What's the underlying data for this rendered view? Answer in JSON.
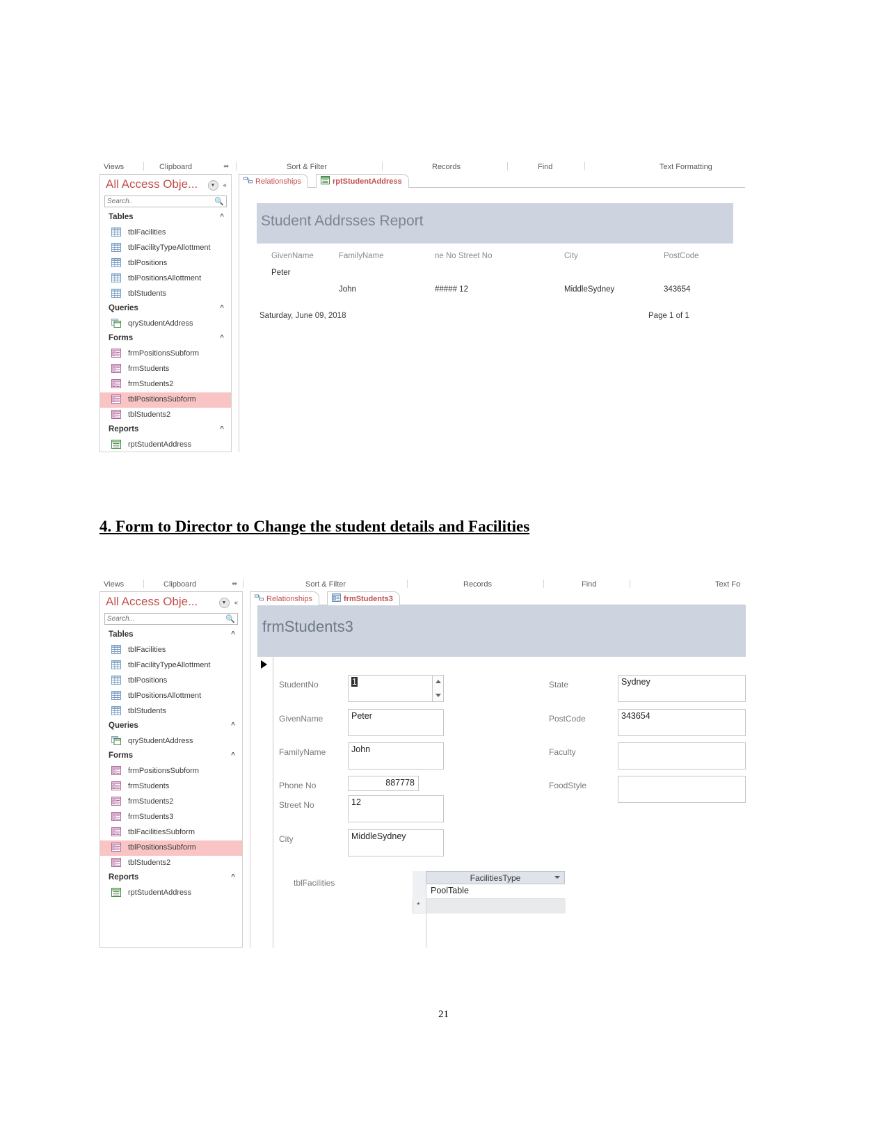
{
  "document": {
    "page_number": "21",
    "heading": "4. Form to Director to Change the student details and Facilities"
  },
  "screenshot_report": {
    "ribbon_groups": [
      "Views",
      "Clipboard",
      "Sort & Filter",
      "Records",
      "Find",
      "Text Formatting"
    ],
    "dialog_launcher": "⬌",
    "nav_pane": {
      "title": "All Access Obje...",
      "dropdown_icon": "chevron-down-icon",
      "collapse_icon": "«",
      "search_placeholder": "Search..",
      "search_icon": "search-icon",
      "groups": [
        {
          "label": "Tables",
          "collapse_chevron": "«",
          "items": [
            {
              "label": "tblFacilities",
              "icon": "table-icon"
            },
            {
              "label": "tblFacilityTypeAllottment",
              "icon": "table-icon"
            },
            {
              "label": "tblPositions",
              "icon": "table-icon"
            },
            {
              "label": "tblPositionsAllottment",
              "icon": "table-icon"
            },
            {
              "label": "tblStudents",
              "icon": "table-icon"
            }
          ]
        },
        {
          "label": "Queries",
          "collapse_chevron": "«",
          "items": [
            {
              "label": "qryStudentAddress",
              "icon": "query-icon"
            }
          ]
        },
        {
          "label": "Forms",
          "collapse_chevron": "«",
          "items": [
            {
              "label": "frmPositionsSubform",
              "icon": "form-icon"
            },
            {
              "label": "frmStudents",
              "icon": "form-icon"
            },
            {
              "label": "frmStudents2",
              "icon": "form-icon"
            },
            {
              "label": "tblPositionsSubform",
              "icon": "form-icon",
              "selected": true
            },
            {
              "label": "tblStudents2",
              "icon": "form-icon"
            }
          ]
        },
        {
          "label": "Reports",
          "collapse_chevron": "«",
          "items": [
            {
              "label": "rptStudentAddress",
              "icon": "report-icon"
            }
          ]
        }
      ]
    },
    "tabs": [
      {
        "label": "Relationships",
        "icon": "relationships-icon",
        "active": false
      },
      {
        "label": "rptStudentAddress",
        "icon": "report-icon",
        "active": true
      }
    ],
    "report": {
      "title": "Student Addrsses Report",
      "columns": [
        "GivenName",
        "FamilyName",
        "ne No Street No",
        "City",
        "PostCode"
      ],
      "rows": [
        {
          "GivenName": "Peter",
          "FamilyName": "",
          "PhoneStreet": "",
          "City": "",
          "PostCode": ""
        },
        {
          "GivenName": "",
          "FamilyName": "John",
          "PhoneStreet": "#####  12",
          "City": "MiddleSydney",
          "PostCode": "343654"
        }
      ],
      "footer_date": "Saturday, June 09, 2018",
      "footer_page": "Page 1 of 1"
    }
  },
  "screenshot_form": {
    "ribbon_groups": [
      "Views",
      "Clipboard",
      "Sort & Filter",
      "Records",
      "Find",
      "Text Fo"
    ],
    "dialog_launcher": "⬌",
    "nav_pane": {
      "title": "All Access Obje...",
      "dropdown_icon": "chevron-down-icon",
      "collapse_icon": "«",
      "search_placeholder": "Search...",
      "search_icon": "search-icon",
      "groups": [
        {
          "label": "Tables",
          "collapse_chevron": "«",
          "items": [
            {
              "label": "tblFacilities",
              "icon": "table-icon"
            },
            {
              "label": "tblFacilityTypeAllottment",
              "icon": "table-icon"
            },
            {
              "label": "tblPositions",
              "icon": "table-icon"
            },
            {
              "label": "tblPositionsAllottment",
              "icon": "table-icon"
            },
            {
              "label": "tblStudents",
              "icon": "table-icon"
            }
          ]
        },
        {
          "label": "Queries",
          "collapse_chevron": "«",
          "items": [
            {
              "label": "qryStudentAddress",
              "icon": "query-icon"
            }
          ]
        },
        {
          "label": "Forms",
          "collapse_chevron": "«",
          "items": [
            {
              "label": "frmPositionsSubform",
              "icon": "form-icon"
            },
            {
              "label": "frmStudents",
              "icon": "form-icon"
            },
            {
              "label": "frmStudents2",
              "icon": "form-icon"
            },
            {
              "label": "frmStudents3",
              "icon": "form-icon"
            },
            {
              "label": "tblFacilitiesSubform",
              "icon": "form-icon"
            },
            {
              "label": "tblPositionsSubform",
              "icon": "form-icon",
              "selected": true
            },
            {
              "label": "tblStudents2",
              "icon": "form-icon"
            }
          ]
        },
        {
          "label": "Reports",
          "collapse_chevron": "«",
          "items": [
            {
              "label": "rptStudentAddress",
              "icon": "report-icon"
            }
          ]
        }
      ]
    },
    "tabs": [
      {
        "label": "Relationships",
        "icon": "relationships-icon",
        "active": false
      },
      {
        "label": "frmStudents3",
        "icon": "form-icon",
        "active": true
      }
    ],
    "form": {
      "title": "frmStudents3",
      "fields_left": [
        {
          "label": "StudentNo",
          "value": "1",
          "spinner": true,
          "selected": true
        },
        {
          "label": "GivenName",
          "value": "Peter"
        },
        {
          "label": "FamilyName",
          "value": "John"
        },
        {
          "label": "Phone No",
          "value": "887778",
          "align": "right"
        },
        {
          "label": "Street No",
          "value": "12"
        },
        {
          "label": "City",
          "value": "MiddleSydney"
        }
      ],
      "fields_right": [
        {
          "label": "State",
          "value": "Sydney"
        },
        {
          "label": "PostCode",
          "value": "343654"
        },
        {
          "label": "Faculty",
          "value": ""
        },
        {
          "label": "FoodStyle",
          "value": ""
        }
      ],
      "subform": {
        "label": "tblFacilities",
        "column_header": "FacilitiesType",
        "rows": [
          "PoolTable"
        ],
        "new_row_marker": "*"
      }
    }
  },
  "colors": {
    "nav_title": "#c0504d",
    "selection": "#f9c4c4",
    "header_band": "#cdd4df",
    "tab_text": "#c0504d"
  }
}
